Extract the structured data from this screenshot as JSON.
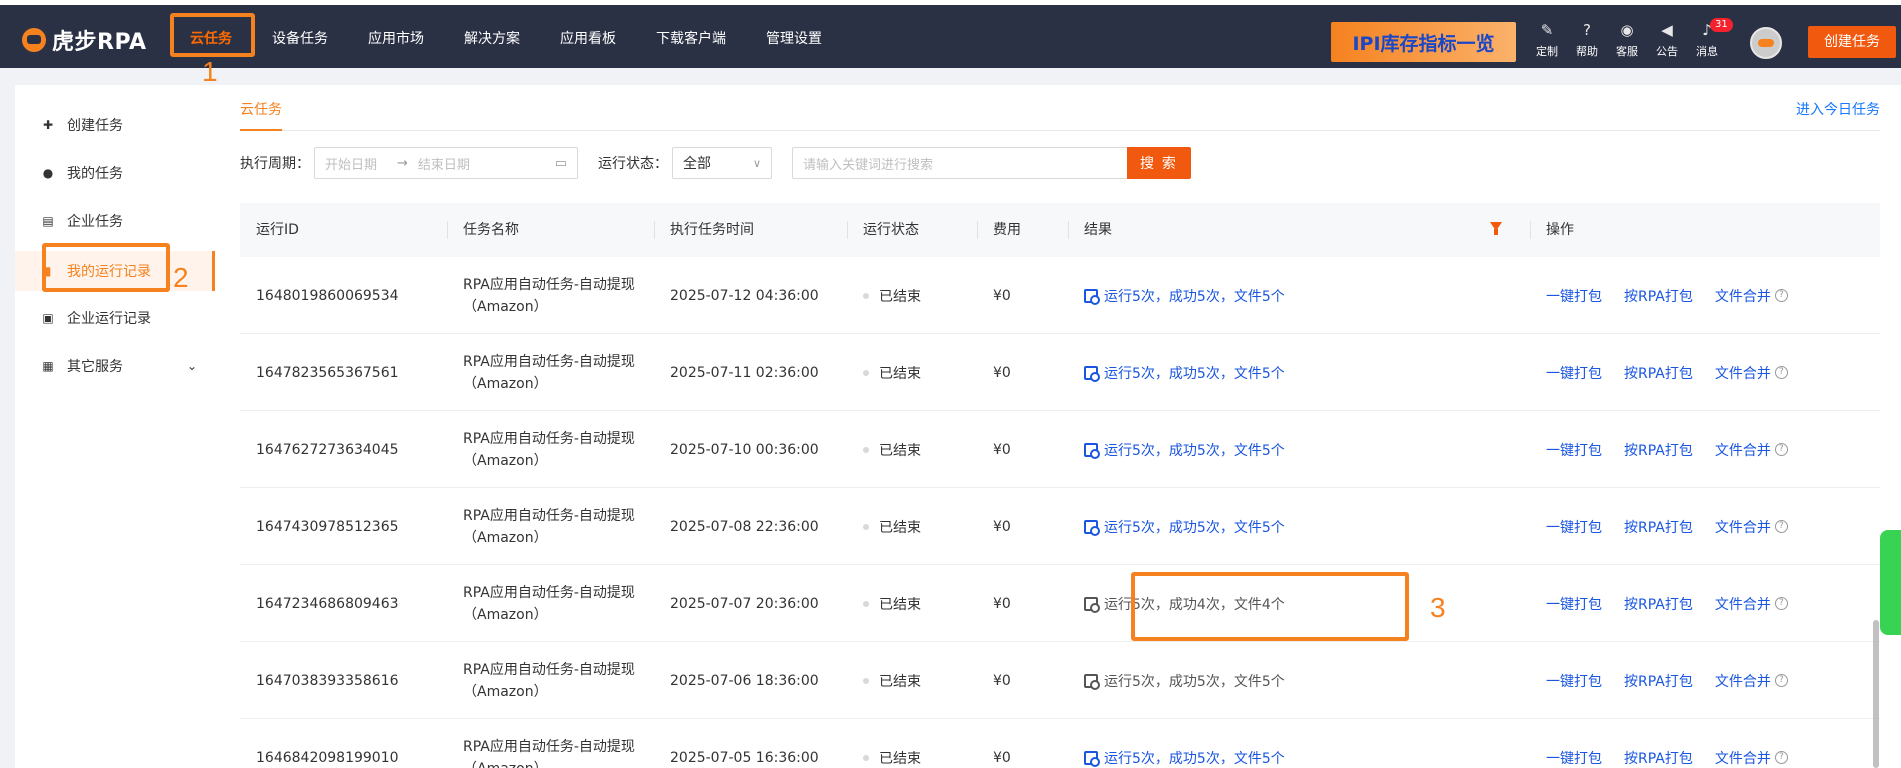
{
  "brand": {
    "name": "虎步RPA"
  },
  "nav": {
    "items": [
      "云任务",
      "设备任务",
      "应用市场",
      "解决方案",
      "应用看板",
      "下载客户端",
      "管理设置"
    ],
    "active_index": 0
  },
  "banner": {
    "text": "IPI库存指标一览"
  },
  "tools": [
    {
      "label": "定制",
      "icon": "edit-icon"
    },
    {
      "label": "帮助",
      "icon": "help-icon"
    },
    {
      "label": "客服",
      "icon": "headset-icon"
    },
    {
      "label": "公告",
      "icon": "megaphone-icon"
    },
    {
      "label": "消息",
      "icon": "bell-icon",
      "badge": "31"
    }
  ],
  "create_task_button": "创建任务",
  "annotations": {
    "one": "1",
    "two": "2",
    "three": "3"
  },
  "sidebar": {
    "items": [
      {
        "label": "创建任务",
        "icon": "plus-square-icon"
      },
      {
        "label": "我的任务",
        "icon": "user-icon"
      },
      {
        "label": "企业任务",
        "icon": "building-icon"
      },
      {
        "label": "我的运行记录",
        "icon": "record-icon",
        "active": true
      },
      {
        "label": "企业运行记录",
        "icon": "enterprise-record-icon"
      },
      {
        "label": "其它服务",
        "icon": "grid-icon",
        "expandable": true
      }
    ]
  },
  "main": {
    "tab": "云任务",
    "today_link": "进入今日任务",
    "filters": {
      "period_label": "执行周期：",
      "start_placeholder": "开始日期",
      "end_placeholder": "结束日期",
      "status_label": "运行状态：",
      "status_value": "全部",
      "search_placeholder": "请输入关键词进行搜索",
      "search_button": "搜 索"
    },
    "columns": [
      "运行ID",
      "任务名称",
      "执行任务时间",
      "运行状态",
      "费用",
      "结果",
      "操作"
    ],
    "rows": [
      {
        "id": "1648019860069534",
        "name1": "RPA应用自动任务-自动提现",
        "name2": "（Amazon）",
        "time": "2025-07-12 04:36:00",
        "status": "已结束",
        "fee": "¥0",
        "result": "运行5次，成功5次，文件5个",
        "result_active": true
      },
      {
        "id": "1647823565367561",
        "name1": "RPA应用自动任务-自动提现",
        "name2": "（Amazon）",
        "time": "2025-07-11 02:36:00",
        "status": "已结束",
        "fee": "¥0",
        "result": "运行5次，成功5次，文件5个",
        "result_active": true
      },
      {
        "id": "1647627273634045",
        "name1": "RPA应用自动任务-自动提现",
        "name2": "（Amazon）",
        "time": "2025-07-10 00:36:00",
        "status": "已结束",
        "fee": "¥0",
        "result": "运行5次，成功5次，文件5个",
        "result_active": true
      },
      {
        "id": "1647430978512365",
        "name1": "RPA应用自动任务-自动提现",
        "name2": "（Amazon）",
        "time": "2025-07-08 22:36:00",
        "status": "已结束",
        "fee": "¥0",
        "result": "运行5次，成功5次，文件5个",
        "result_active": true
      },
      {
        "id": "1647234686809463",
        "name1": "RPA应用自动任务-自动提现",
        "name2": "（Amazon）",
        "time": "2025-07-07 20:36:00",
        "status": "已结束",
        "fee": "¥0",
        "result": "运行5次，成功4次，文件4个",
        "result_active": false
      },
      {
        "id": "1647038393358616",
        "name1": "RPA应用自动任务-自动提现",
        "name2": "（Amazon）",
        "time": "2025-07-06 18:36:00",
        "status": "已结束",
        "fee": "¥0",
        "result": "运行5次，成功5次，文件5个",
        "result_active": false
      },
      {
        "id": "1646842098199010",
        "name1": "RPA应用自动任务-自动提现",
        "name2": "（Amazon）",
        "time": "2025-07-05 16:36:00",
        "status": "已结束",
        "fee": "¥0",
        "result": "运行5次，成功5次，文件5个",
        "result_active": true
      }
    ],
    "row_actions": {
      "pack": "一键打包",
      "pack_rpa": "按RPA打包",
      "merge": "文件合并"
    }
  },
  "colors": {
    "accent": "#f5821f",
    "link": "#1a56e0",
    "topbar": "#2b3145"
  }
}
